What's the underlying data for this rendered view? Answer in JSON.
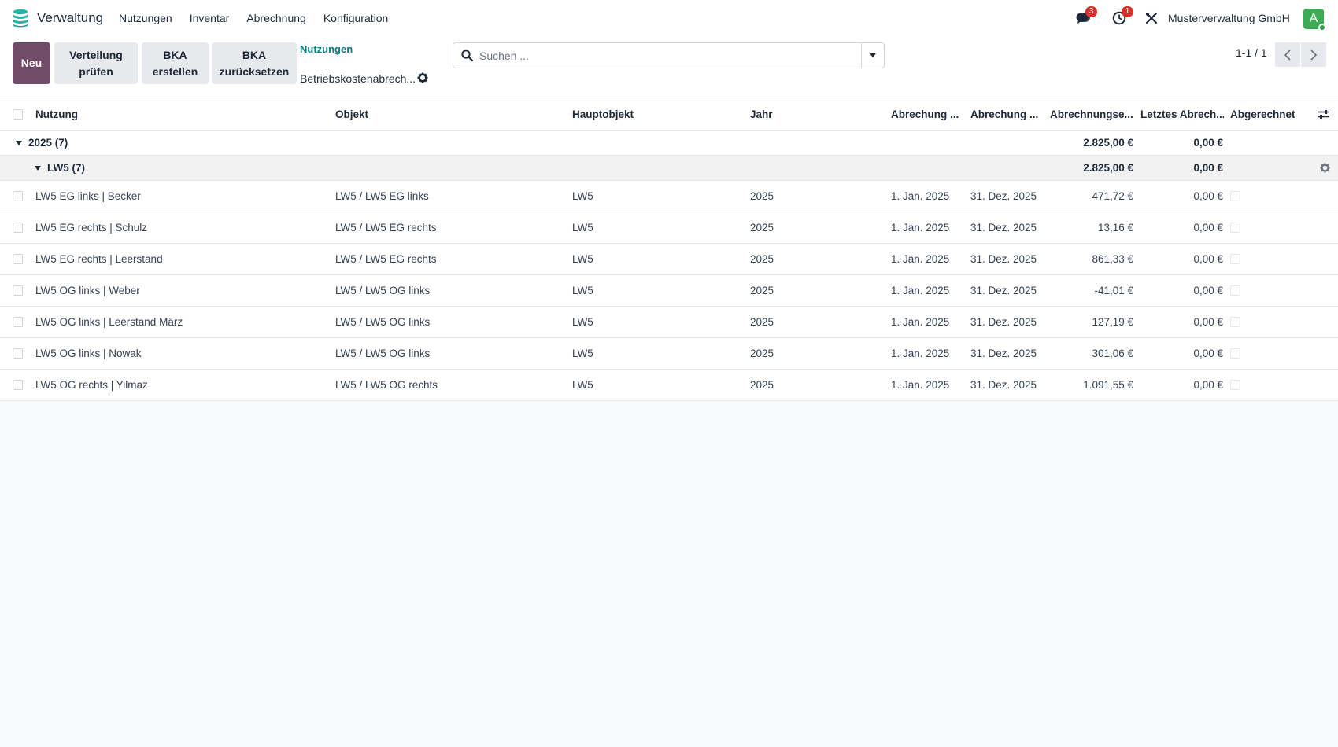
{
  "app": {
    "name": "Verwaltung"
  },
  "menu": [
    "Nutzungen",
    "Inventar",
    "Abrechnung",
    "Konfiguration"
  ],
  "systray": {
    "messages_count": "3",
    "activities_count": "1",
    "company": "Musterverwaltung GmbH",
    "avatar_letter": "A"
  },
  "toolbar": {
    "new_label": "Neu",
    "check_label": "Verteilung\nprüfen",
    "create_label": "BKA\nerstellen",
    "reset_label": "BKA\nzurücksetzen"
  },
  "breadcrumb": {
    "parent": "Nutzungen",
    "current": "Betriebskostenabrech..."
  },
  "search": {
    "placeholder": "Suchen ..."
  },
  "pager": {
    "value": "1-1 / 1"
  },
  "columns": {
    "nutzung": "Nutzung",
    "objekt": "Objekt",
    "hauptobjekt": "Hauptobjekt",
    "jahr": "Jahr",
    "start": "Abrechung ...",
    "end": "Abrechung ...",
    "saldo": "Abrechnungse...",
    "last": "Letztes Abrech...",
    "done": "Abgerechnet"
  },
  "groups": {
    "year": {
      "label": "2025 (7)",
      "saldo": "2.825,00 €",
      "last": "0,00 €"
    },
    "object": {
      "label": "LW5 (7)",
      "saldo": "2.825,00 €",
      "last": "0,00 €"
    }
  },
  "rows": [
    {
      "nutzung": "LW5 EG links | Becker",
      "objekt": "LW5 / LW5 EG links",
      "hauptobjekt": "LW5",
      "jahr": "2025",
      "start": "1. Jan. 2025",
      "end": "31. Dez. 2025",
      "saldo": "471,72 €",
      "last": "0,00 €"
    },
    {
      "nutzung": "LW5 EG rechts | Schulz",
      "objekt": "LW5 / LW5 EG rechts",
      "hauptobjekt": "LW5",
      "jahr": "2025",
      "start": "1. Jan. 2025",
      "end": "31. Dez. 2025",
      "saldo": "13,16 €",
      "last": "0,00 €"
    },
    {
      "nutzung": "LW5 EG rechts | Leerstand",
      "objekt": "LW5 / LW5 EG rechts",
      "hauptobjekt": "LW5",
      "jahr": "2025",
      "start": "1. Jan. 2025",
      "end": "31. Dez. 2025",
      "saldo": "861,33 €",
      "last": "0,00 €"
    },
    {
      "nutzung": "LW5 OG links | Weber",
      "objekt": "LW5 / LW5 OG links",
      "hauptobjekt": "LW5",
      "jahr": "2025",
      "start": "1. Jan. 2025",
      "end": "31. Dez. 2025",
      "saldo": "-41,01 €",
      "last": "0,00 €"
    },
    {
      "nutzung": "LW5 OG links | Leerstand März",
      "objekt": "LW5 / LW5 OG links",
      "hauptobjekt": "LW5",
      "jahr": "2025",
      "start": "1. Jan. 2025",
      "end": "31. Dez. 2025",
      "saldo": "127,19 €",
      "last": "0,00 €"
    },
    {
      "nutzung": "LW5 OG links | Nowak",
      "objekt": "LW5 / LW5 OG links",
      "hauptobjekt": "LW5",
      "jahr": "2025",
      "start": "1. Jan. 2025",
      "end": "31. Dez. 2025",
      "saldo": "301,06 €",
      "last": "0,00 €"
    },
    {
      "nutzung": "LW5 OG rechts | Yilmaz",
      "objekt": "LW5 / LW5 OG rechts",
      "hauptobjekt": "LW5",
      "jahr": "2025",
      "start": "1. Jan. 2025",
      "end": "31. Dez. 2025",
      "saldo": "1.091,55 €",
      "last": "0,00 €"
    }
  ]
}
